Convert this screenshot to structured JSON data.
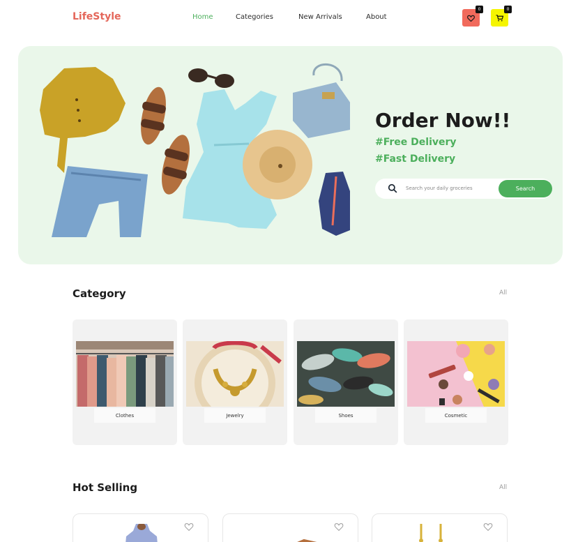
{
  "brand": {
    "name": "LifeStyle",
    "color": "#e4665a"
  },
  "nav": {
    "items": [
      {
        "label": "Home",
        "active": true
      },
      {
        "label": "Categories",
        "active": false
      },
      {
        "label": "New Arrivals",
        "active": false
      },
      {
        "label": "About",
        "active": false
      }
    ],
    "wishlist_count": "0",
    "cart_count": "0"
  },
  "hero": {
    "title": "Order Now!!",
    "tag1": "#Free Delivery",
    "tag2": "#Fast Delivery",
    "search": {
      "placeholder": "Search your daily groceries",
      "button": "Search"
    }
  },
  "category": {
    "title": "Category",
    "all_label": "All",
    "items": [
      {
        "label": "Clothes"
      },
      {
        "label": "Jewelry"
      },
      {
        "label": "Shoes"
      },
      {
        "label": "Cosmetic"
      }
    ]
  },
  "hot_selling": {
    "title": "Hot Selling",
    "all_label": "All"
  },
  "colors": {
    "accent": "#4caf5c",
    "hero_bg": "#eaf7ea",
    "heart_btn": "#f16a5c",
    "cart_btn": "#f5f500"
  }
}
